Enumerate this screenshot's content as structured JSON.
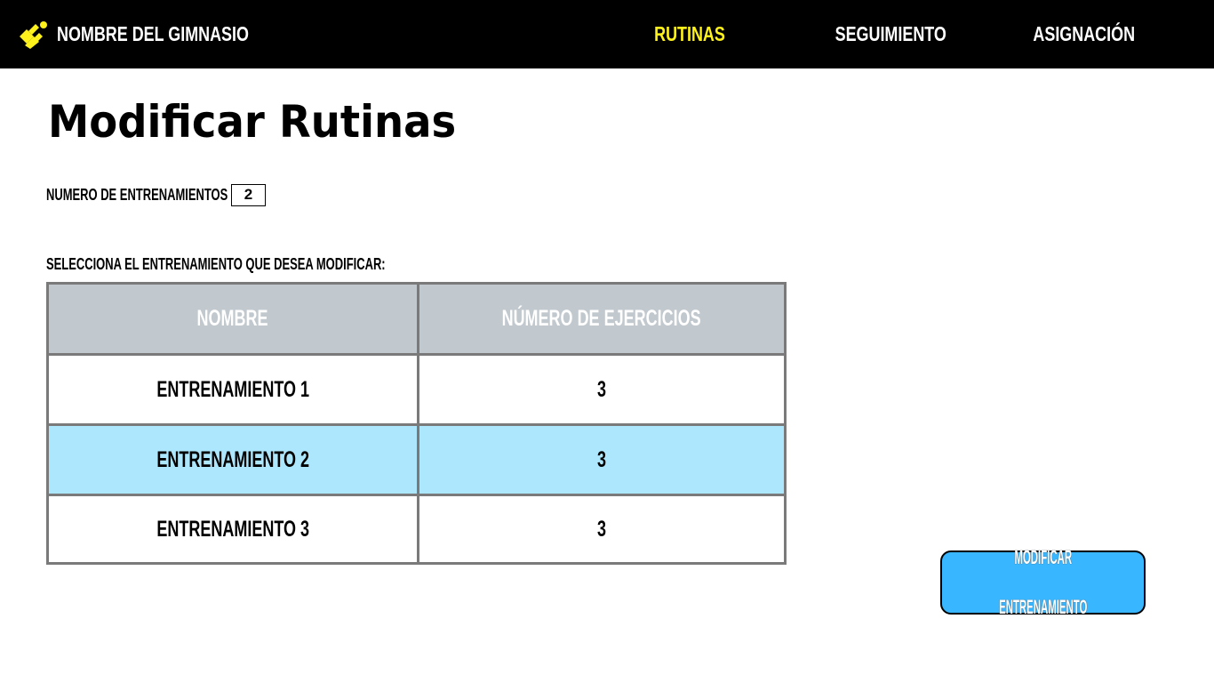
{
  "header": {
    "brand": "NOMBRE DEL GIMNASIO",
    "nav": [
      "RUTINAS",
      "SEGUIMIENTO",
      "ASIGNACIÓN"
    ],
    "active_nav": "RUTINAS",
    "logo_icon": "gym-logo-icon",
    "accent_color": "#fff21c"
  },
  "main": {
    "title": "Modificar Rutinas",
    "count_label": "NUMERO DE ENTRENAMIENTOS",
    "count_value": "2",
    "select_label": "SELECCIONA EL ENTRENAMIENTO QUE DESEA MODIFICAR:",
    "table": {
      "columns": [
        "NOMBRE",
        "NÚMERO DE EJERCICIOS"
      ],
      "rows": [
        {
          "name": "ENTRENAMIENTO 1",
          "exercises": "3",
          "selected": false
        },
        {
          "name": "ENTRENAMIENTO 2",
          "exercises": "3",
          "selected": true
        },
        {
          "name": "ENTRENAMIENTO 3",
          "exercises": "3",
          "selected": false
        }
      ],
      "header_color": "#c1c8ce",
      "selected_color": "#ade7fd"
    },
    "action_button": [
      "MODIFICAR",
      "ENTRENAMIENTO"
    ],
    "button_color": "#38b6ff"
  }
}
